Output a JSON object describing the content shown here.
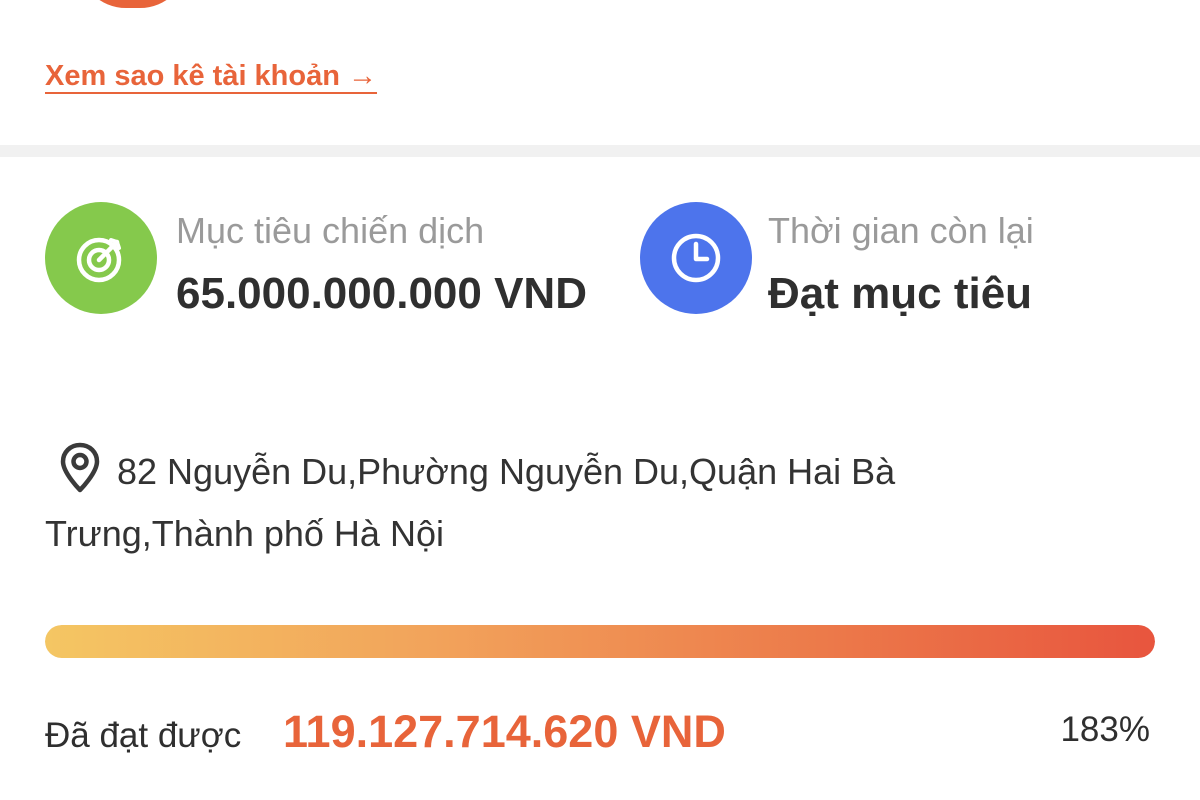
{
  "header": {
    "statement_link_label": "Xem sao kê tài khoản →"
  },
  "stats": {
    "goal": {
      "icon": "target-icon",
      "label": "Mục tiêu chiến dịch",
      "value": "65.000.000.000 VND"
    },
    "time": {
      "icon": "clock-icon",
      "label": "Thời gian còn lại",
      "value": "Đạt mục tiêu"
    }
  },
  "location": {
    "icon": "location-pin-icon",
    "address": "82 Nguyễn Du,Phường Nguyễn Du,Quận Hai Bà Trưng,Thành phố Hà Nội"
  },
  "progress": {
    "label": "Đã đạt được",
    "amount": "119.127.714.620 VND",
    "percent_text": "183%",
    "fill_fraction": 1.0
  },
  "colors": {
    "accent": "#e8643a",
    "goal_icon_bg": "#85c94c",
    "time_icon_bg": "#4d74ec",
    "progress_start": "#f4c663",
    "progress_end": "#e8553e"
  }
}
